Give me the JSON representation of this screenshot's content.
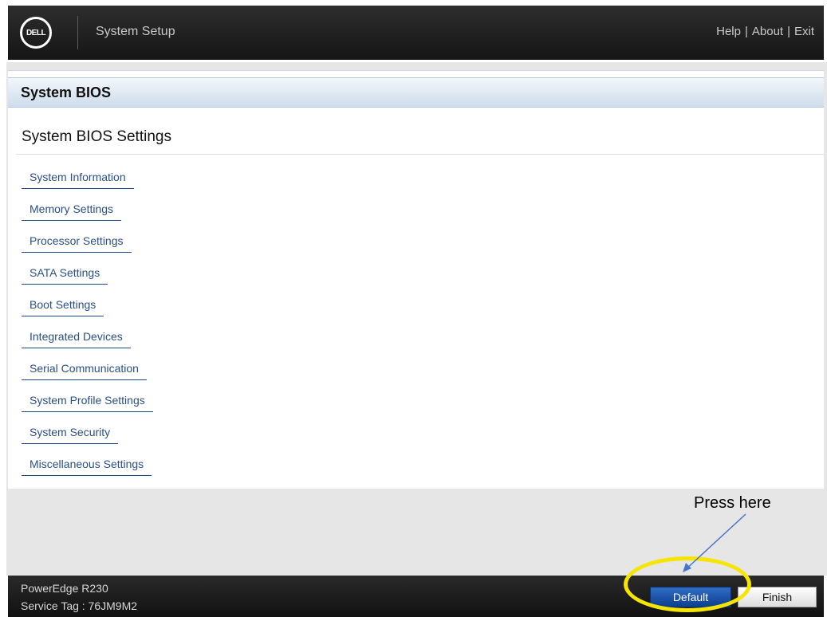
{
  "header": {
    "logo_text": "DELL",
    "app_title": "System Setup",
    "links": [
      "Help",
      "About",
      "Exit"
    ],
    "separator": "|"
  },
  "section": {
    "title": "System BIOS"
  },
  "page": {
    "title": "System BIOS Settings",
    "menu": [
      "System Information",
      "Memory Settings",
      "Processor Settings",
      "SATA Settings",
      "Boot Settings",
      "Integrated Devices",
      "Serial Communication",
      "System Profile Settings",
      "System Security",
      "Miscellaneous Settings"
    ]
  },
  "annotation": {
    "text": "Press here",
    "highlight_color": "#f5e500",
    "arrow_color": "#4a74c9"
  },
  "footer": {
    "model": "PowerEdge R230",
    "service_tag": "Service Tag : 76JM9M2",
    "default_label": "Default",
    "finish_label": "Finish"
  },
  "colors": {
    "accent": "#1f57a8",
    "link": "#2a4f86"
  }
}
